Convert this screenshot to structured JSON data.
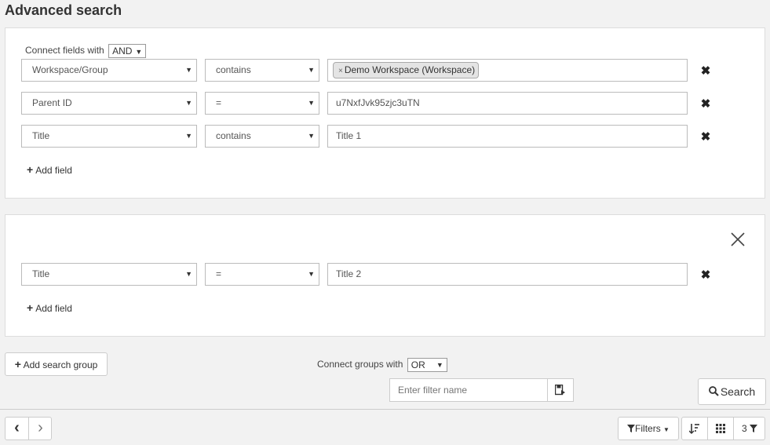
{
  "page": {
    "title": "Advanced search"
  },
  "group1": {
    "connect_label": "Connect fields with",
    "connect_value": "AND",
    "rows": [
      {
        "field": "Workspace/Group",
        "operator": "contains",
        "tag": "Demo Workspace (Workspace)",
        "tag_remove": "×"
      },
      {
        "field": "Parent ID",
        "operator": "=",
        "value": "u7NxfJvk95zjc3uTN"
      },
      {
        "field": "Title",
        "operator": "contains",
        "value": "Title 1"
      }
    ],
    "add_field": "Add field"
  },
  "group2": {
    "rows": [
      {
        "field": "Title",
        "operator": "=",
        "value": "Title 2"
      }
    ],
    "add_field": "Add field"
  },
  "footer": {
    "add_group": "Add search group",
    "connect_groups_label": "Connect groups with",
    "connect_groups_value": "OR",
    "filter_name_placeholder": "Enter filter name",
    "search": "Search"
  },
  "toolbar": {
    "prev": "‹",
    "next": "›",
    "filters": "Filters",
    "filter_count": "3"
  },
  "icons": {
    "remove": "✖",
    "close_group": "close-icon",
    "save_filter": "save-filter-icon",
    "search": "search-icon",
    "funnel": "funnel-icon",
    "sort": "sort-icon",
    "grid": "grid-icon"
  }
}
